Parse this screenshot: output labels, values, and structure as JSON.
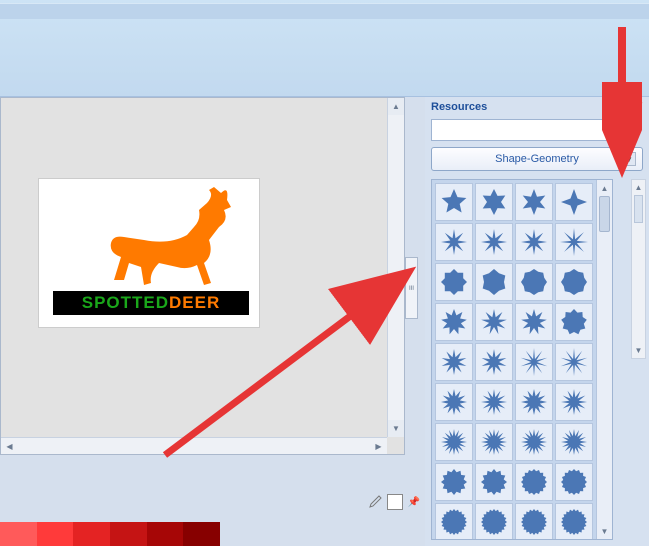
{
  "panel": {
    "title": "Resources",
    "search_value": "",
    "dropdown_label": "Shape-Geometry"
  },
  "logo": {
    "word_part1": "SPOTTED",
    "word_part2": "DEER"
  },
  "colors": {
    "palette": [
      "#ff5a5a",
      "#ff3a3a",
      "#e42323",
      "#c51414",
      "#a60606",
      "#870000"
    ]
  },
  "shapes": {
    "names": [
      "star-5",
      "star-6",
      "star-6b",
      "star-4",
      "star-8-thin",
      "star-8-thin2",
      "star-8-thin3",
      "spark-8",
      "octagon",
      "hex-round",
      "round-8a",
      "round-8b",
      "nona-star",
      "burst-9",
      "star-9",
      "enneagon",
      "burst-10",
      "burst-10b",
      "spark-thin",
      "spark-thin2",
      "star-12",
      "burst-12",
      "star-12b",
      "burst-12b",
      "burst-16",
      "burst-16b",
      "burst-16c",
      "burst-16d",
      "seal-12",
      "seal-12b",
      "seal-16",
      "seal-16b",
      "seal-20",
      "seal-20b",
      "seal-20c",
      "seal-20d"
    ]
  }
}
